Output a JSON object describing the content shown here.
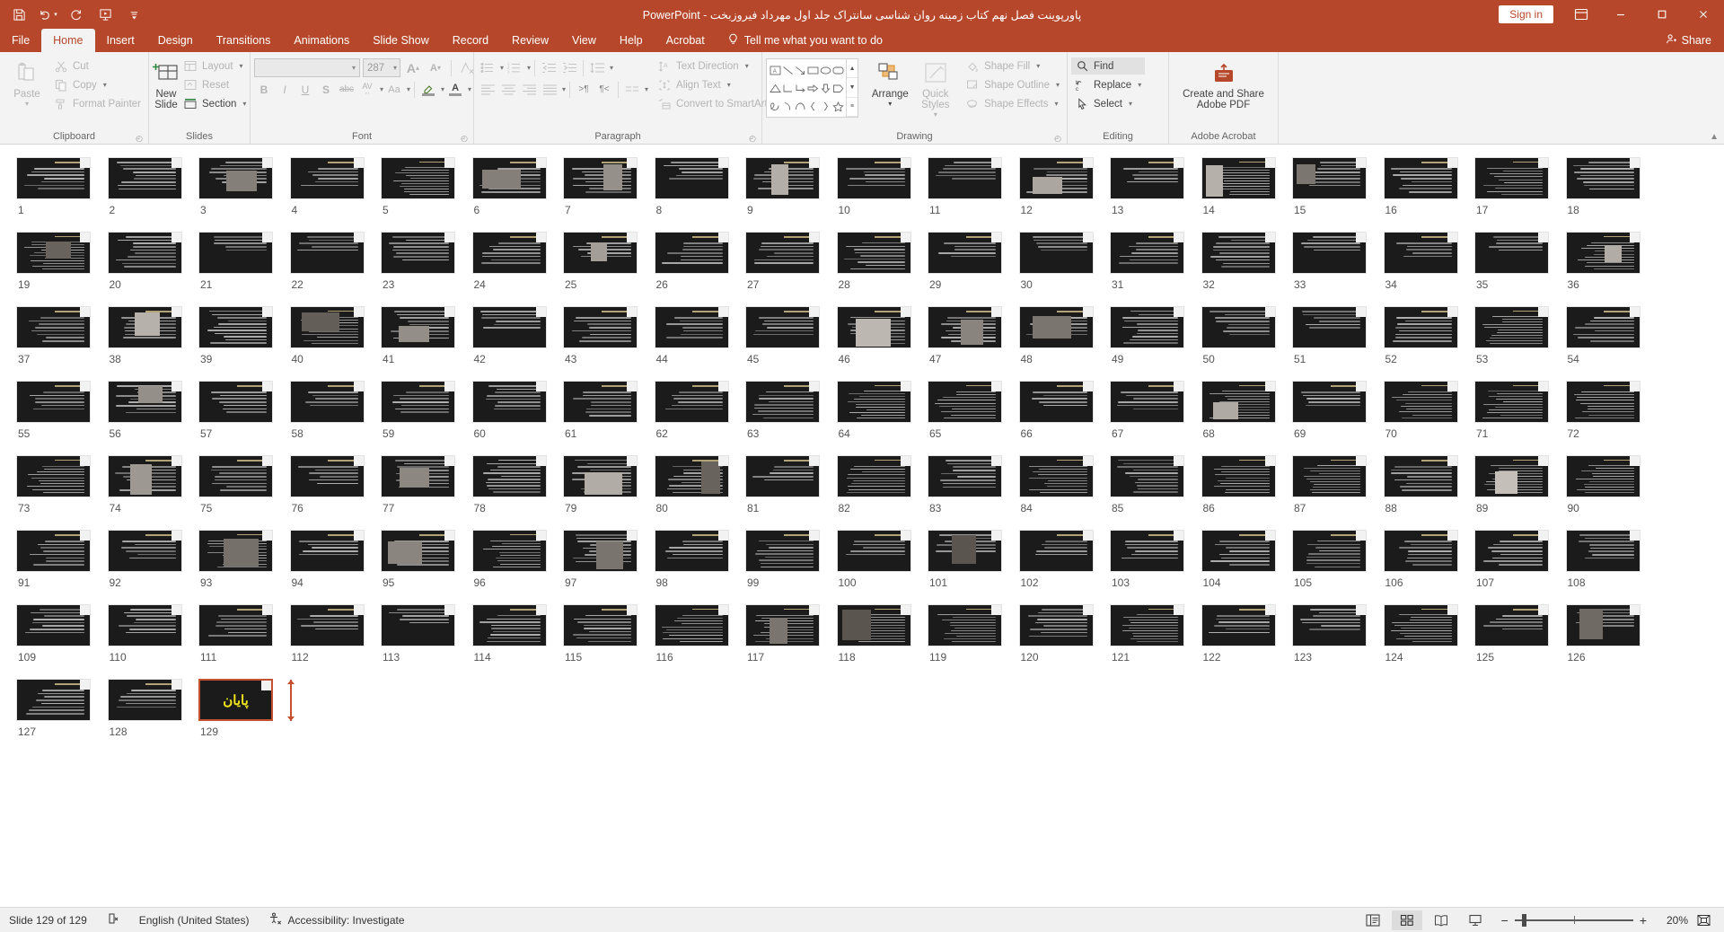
{
  "titlebar": {
    "quick_access": [
      {
        "name": "save-icon",
        "label": "Save"
      },
      {
        "name": "undo-icon",
        "label": "Undo"
      },
      {
        "name": "redo-icon",
        "label": "Redo"
      },
      {
        "name": "start-from-beginning-icon",
        "label": "Start From Beginning"
      },
      {
        "name": "customize-quick-access-toolbar-icon",
        "label": "Customize Quick Access Toolbar"
      }
    ],
    "document_title": "پاورپوینت فصل نهم کتاب زمینه روان شناسی سانتراک جلد اول مهرداد فیروزبخت",
    "app_name": "PowerPoint",
    "separator": "-",
    "sign_in": "Sign in",
    "ribbon_display_options": "Ribbon Display Options",
    "minimize": "Minimize",
    "restore": "Restore Down",
    "close": "Close"
  },
  "tabs": [
    {
      "label": "File",
      "active": false
    },
    {
      "label": "Home",
      "active": true
    },
    {
      "label": "Insert",
      "active": false
    },
    {
      "label": "Design",
      "active": false
    },
    {
      "label": "Transitions",
      "active": false
    },
    {
      "label": "Animations",
      "active": false
    },
    {
      "label": "Slide Show",
      "active": false
    },
    {
      "label": "Record",
      "active": false
    },
    {
      "label": "Review",
      "active": false
    },
    {
      "label": "View",
      "active": false
    },
    {
      "label": "Help",
      "active": false
    },
    {
      "label": "Acrobat",
      "active": false
    }
  ],
  "tell_me": "Tell me what you want to do",
  "share": "Share",
  "ribbon": {
    "clipboard": {
      "label": "Clipboard",
      "paste": "Paste",
      "cut": "Cut",
      "copy": "Copy",
      "format_painter": "Format Painter"
    },
    "slides": {
      "label": "Slides",
      "new_slide": "New",
      "new_slide2": "Slide",
      "layout": "Layout",
      "reset": "Reset",
      "section": "Section"
    },
    "font": {
      "label": "Font",
      "font_name": "",
      "font_size": "287",
      "bold": "B",
      "italic": "I",
      "underline": "U",
      "shadow": "S",
      "strikethrough": "abc",
      "character_spacing": "AV",
      "change_case": "Aa",
      "increase_font": "A",
      "decrease_font": "A",
      "clear_formatting": "A"
    },
    "paragraph": {
      "label": "Paragraph",
      "text_direction": "Text Direction",
      "align_text": "Align Text",
      "convert_to_smartart": "Convert to SmartArt"
    },
    "drawing": {
      "label": "Drawing",
      "arrange": "Arrange",
      "quick_styles": "Quick",
      "quick_styles2": "Styles",
      "shape_fill": "Shape Fill",
      "shape_outline": "Shape Outline",
      "shape_effects": "Shape Effects"
    },
    "editing": {
      "label": "Editing",
      "find": "Find",
      "replace": "Replace",
      "select": "Select"
    },
    "adobe": {
      "label": "Adobe Acrobat",
      "create_and_share": "Create and Share",
      "create_and_share2": "Adobe PDF"
    }
  },
  "sorter": {
    "total_slides": 129,
    "selected_slide": 129,
    "last_slide_text": "پایان",
    "image_slides": [
      3,
      6,
      7,
      9,
      12,
      14,
      15,
      19,
      25,
      36,
      38,
      40,
      41,
      46,
      47,
      48,
      56,
      68,
      74,
      77,
      79,
      80,
      89,
      93,
      95,
      97,
      101,
      117,
      118,
      126
    ],
    "slide_numbers": [
      1,
      2,
      3,
      4,
      5,
      6,
      7,
      8,
      9,
      10,
      11,
      12,
      13,
      14,
      15,
      16,
      17,
      18,
      19,
      20,
      21,
      22,
      23,
      24,
      25,
      26,
      27,
      28,
      29,
      30,
      31,
      32,
      33,
      34,
      35,
      36,
      37,
      38,
      39,
      40,
      41,
      42,
      43,
      44,
      45,
      46,
      47,
      48,
      49,
      50,
      51,
      52,
      53,
      54,
      55,
      56,
      57,
      58,
      59,
      60,
      61,
      62,
      63,
      64,
      65,
      66,
      67,
      68,
      69,
      70,
      71,
      72,
      73,
      74,
      75,
      76,
      77,
      78,
      79,
      80,
      81,
      82,
      83,
      84,
      85,
      86,
      87,
      88,
      89,
      90,
      91,
      92,
      93,
      94,
      95,
      96,
      97,
      98,
      99,
      100,
      101,
      102,
      103,
      104,
      105,
      106,
      107,
      108,
      109,
      110,
      111,
      112,
      113,
      114,
      115,
      116,
      117,
      118,
      119,
      120,
      121,
      122,
      123,
      124,
      125,
      126,
      127,
      128,
      129
    ]
  },
  "statusbar": {
    "slide_indicator": "Slide 129 of 129",
    "language": "English (United States)",
    "accessibility": "Accessibility: Investigate",
    "zoom_level": "20%",
    "views": [
      {
        "name": "normal-view-button",
        "label": "Normal",
        "active": false
      },
      {
        "name": "slide-sorter-view-button",
        "label": "Slide Sorter",
        "active": true
      },
      {
        "name": "reading-view-button",
        "label": "Reading View",
        "active": false
      },
      {
        "name": "slide-show-button",
        "label": "Slide Show",
        "active": false
      }
    ],
    "zoom_out": "−",
    "zoom_in": "+",
    "fit_to_window": "Fit slide to current window"
  },
  "colors": {
    "accent": "#b7472a",
    "selection": "#c4512f",
    "ribbon_bg": "#f3f3f3",
    "highlight_text": "#f2e41c"
  }
}
